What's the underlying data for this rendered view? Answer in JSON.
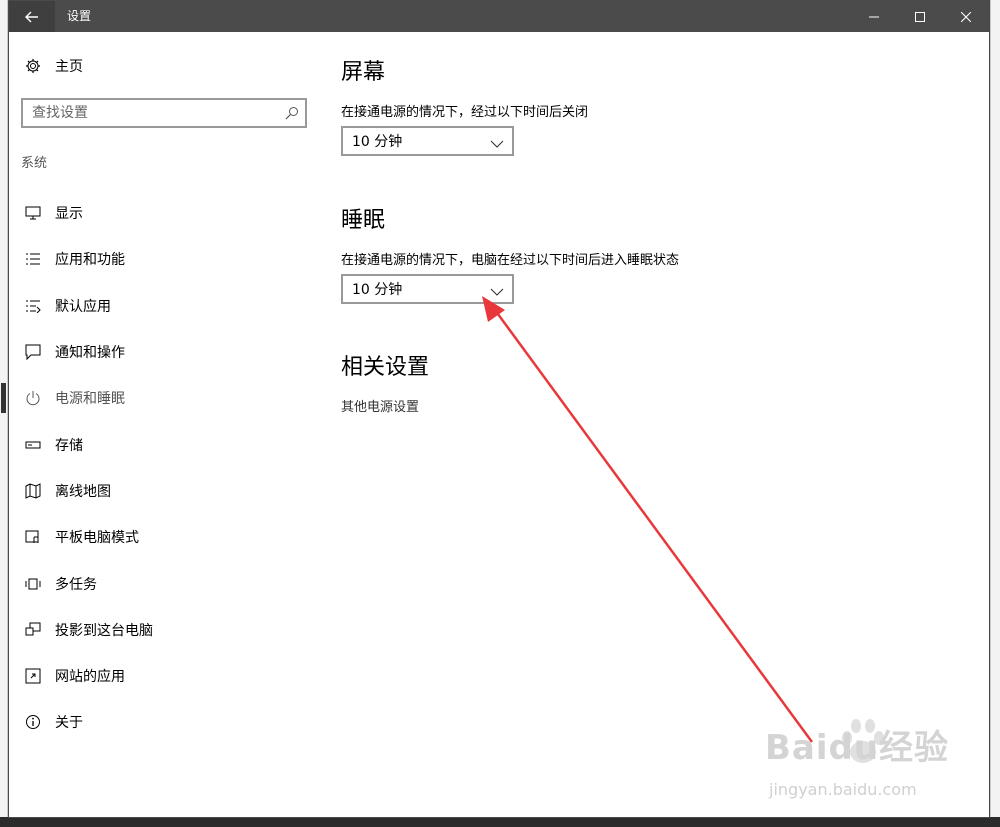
{
  "window": {
    "title": "设置",
    "controls": [
      "minimize-icon",
      "maximize-icon",
      "close-icon"
    ]
  },
  "sidebar": {
    "home_label": "主页",
    "search_placeholder": "查找设置",
    "section_label": "系统",
    "items": [
      {
        "label": "显示",
        "icon": "monitor-icon"
      },
      {
        "label": "应用和功能",
        "icon": "list-icon"
      },
      {
        "label": "默认应用",
        "icon": "default-apps-icon"
      },
      {
        "label": "通知和操作",
        "icon": "notification-icon"
      },
      {
        "label": "电源和睡眠",
        "icon": "power-icon",
        "active": true
      },
      {
        "label": "存储",
        "icon": "storage-icon"
      },
      {
        "label": "离线地图",
        "icon": "map-icon"
      },
      {
        "label": "平板电脑模式",
        "icon": "tablet-mode-icon"
      },
      {
        "label": "多任务",
        "icon": "multitasking-icon"
      },
      {
        "label": "投影到这台电脑",
        "icon": "projection-icon"
      },
      {
        "label": "网站的应用",
        "icon": "web-apps-icon"
      },
      {
        "label": "关于",
        "icon": "info-icon"
      }
    ]
  },
  "main": {
    "screen": {
      "heading": "屏幕",
      "description": "在接通电源的情况下，经过以下时间后关闭",
      "value": "10 分钟"
    },
    "sleep": {
      "heading": "睡眠",
      "description": "在接通电源的情况下，电脑在经过以下时间后进入睡眠状态",
      "value": "10 分钟"
    },
    "related": {
      "heading": "相关设置",
      "link": "其他电源设置"
    }
  },
  "annotation": {
    "arrow_color": "#e8383b"
  },
  "watermark": {
    "brand": "Baidu经验",
    "url": "jingyan.baidu.com"
  }
}
